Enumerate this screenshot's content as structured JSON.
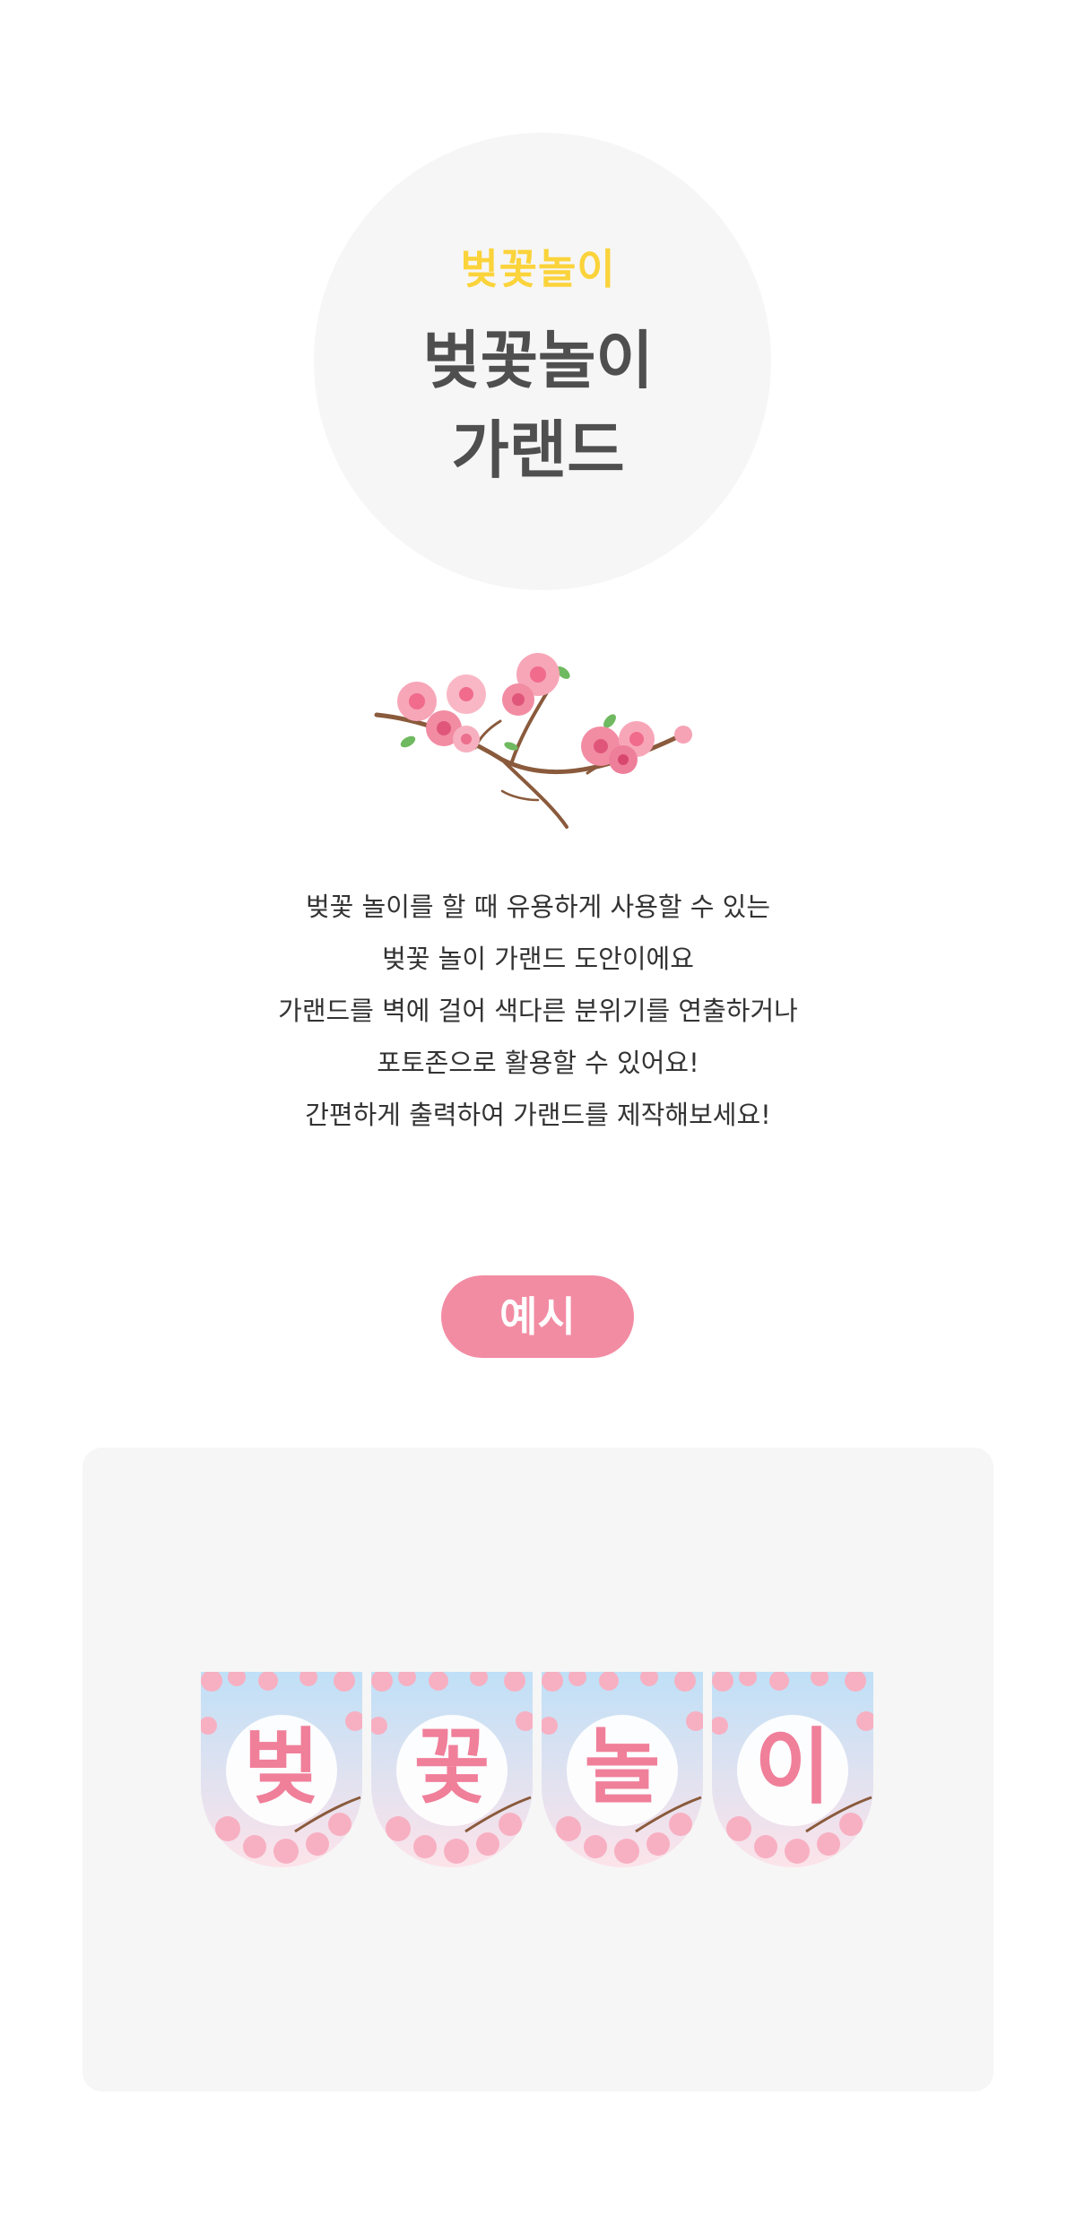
{
  "hero": {
    "eyebrow": "벚꽃놀이",
    "title_line1": "벚꽃놀이",
    "title_line2": "가랜드"
  },
  "illustration": {
    "icon": "cherry-blossom-branch-icon"
  },
  "description": [
    "벚꽃 놀이를 할 때 유용하게 사용할 수 있는",
    "벚꽃 놀이 가랜드 도안이에요",
    "가랜드를 벽에 걸어 색다른 분위기를 연출하거나",
    "포토존으로 활용할 수 있어요!",
    "간편하게 출력하여 가랜드를 제작해보세요!"
  ],
  "example": {
    "label": "예시",
    "flags": [
      "벚",
      "꽃",
      "놀",
      "이"
    ]
  },
  "colors": {
    "accent_yellow": "#fbd33a",
    "accent_pink": "#f28ca3",
    "title_gray": "#4f4f4f",
    "panel_gray": "#f6f6f6"
  }
}
